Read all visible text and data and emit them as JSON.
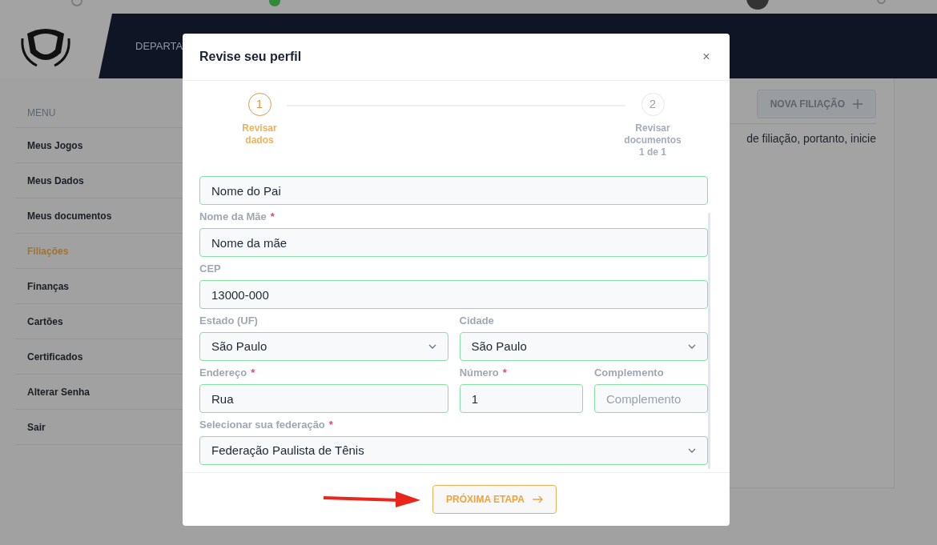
{
  "header": {
    "nav_item": "DEPARTA"
  },
  "sidebar": {
    "heading": "MENU",
    "items": [
      {
        "label": "Meus Jogos",
        "selected": false
      },
      {
        "label": "Meus Dados",
        "selected": false
      },
      {
        "label": "Meus documentos",
        "selected": false
      },
      {
        "label": "Filiações",
        "selected": true
      },
      {
        "label": "Finanças",
        "selected": false
      },
      {
        "label": "Cartões",
        "selected": false
      },
      {
        "label": "Certificados",
        "selected": false
      },
      {
        "label": "Alterar Senha",
        "selected": false
      },
      {
        "label": "Sair",
        "selected": false
      }
    ]
  },
  "main": {
    "button": {
      "label": "NOVA FILIAÇÃO",
      "disabled": true
    },
    "text": "de filiação, portanto, inicie"
  },
  "modal": {
    "title": "Revise seu perfil",
    "close": "×",
    "steps": [
      {
        "number": "1",
        "label": "Revisar dados",
        "selected": true
      },
      {
        "number": "2",
        "label": "Revisar documentos",
        "detail": "1 de 1",
        "selected": false
      }
    ],
    "rows": [
      [
        {
          "kind": "input",
          "value": "Nome do Pai"
        }
      ],
      [
        {
          "kind": "input",
          "label": "Nome da Mãe",
          "required": true,
          "value": "Nome da mãe"
        }
      ],
      [
        {
          "kind": "input",
          "label": "CEP",
          "required": false,
          "value": "13000-000"
        }
      ],
      [
        {
          "kind": "select",
          "label": "Estado (UF)",
          "required": false,
          "value": "São Paulo"
        },
        {
          "kind": "select",
          "label": "Cidade",
          "required": false,
          "value": "São Paulo"
        }
      ],
      [
        {
          "kind": "input",
          "label": "Endereço",
          "required": true,
          "value": "Rua"
        },
        {
          "kind": "input",
          "label": "Número",
          "required": true,
          "value": "1"
        },
        {
          "kind": "input",
          "label": "Complemento",
          "required": false,
          "placeholder": "Complemento"
        }
      ],
      [
        {
          "kind": "select",
          "label": "Selecionar sua federação",
          "required": true,
          "value": "Federação Paulista de Tênis"
        }
      ]
    ],
    "required_mark": "*",
    "next_button": "PRÓXIMA ETAPA"
  }
}
